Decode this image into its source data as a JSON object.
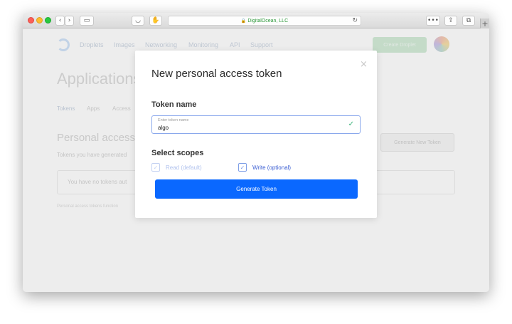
{
  "browser": {
    "url": "DigitalOcean, LLC",
    "reader_icon": "sidebar-icon",
    "more_label": "•••",
    "new_tab_label": "+"
  },
  "background": {
    "nav": [
      "Droplets",
      "Images",
      "Networking",
      "Monitoring",
      "API",
      "Support"
    ],
    "create_button": "Create Droplet",
    "page_title": "Applications",
    "tabs": [
      "Tokens",
      "Apps",
      "Access"
    ],
    "section_title": "Personal access",
    "section_desc": "Tokens you have generated",
    "generate_new_token": "Generate New Token",
    "empty_text": "You have no tokens aut",
    "footer_note": "Personal access tokens function"
  },
  "modal": {
    "title": "New personal access token",
    "token_name_label": "Token name",
    "token_placeholder": "Enter token name",
    "token_value": "algo",
    "select_scopes_label": "Select scopes",
    "scopes": [
      {
        "label": "Read (default)",
        "checked": true,
        "disabled": true
      },
      {
        "label": "Write (optional)",
        "checked": true,
        "disabled": false
      }
    ],
    "generate_button": "Generate Token"
  },
  "colors": {
    "primary": "#0a68ff",
    "success": "#3bb37a",
    "field_border": "#8aa8ec",
    "url_green": "#2f9a3c"
  }
}
